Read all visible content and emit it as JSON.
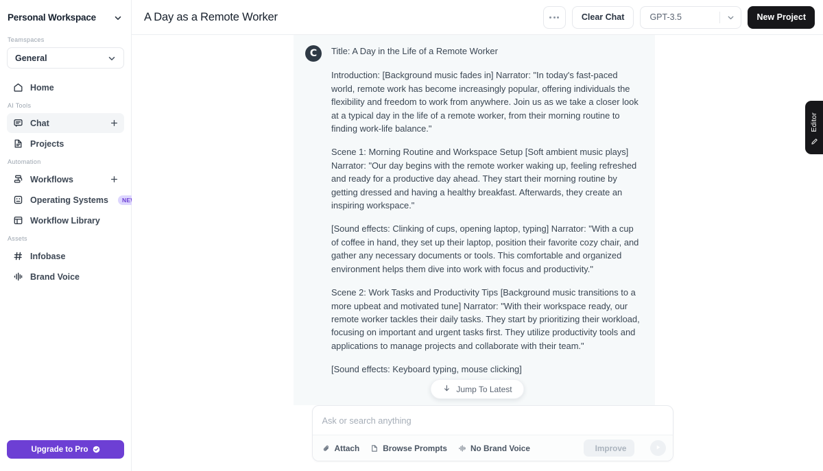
{
  "sidebar": {
    "workspace_title": "Personal Workspace",
    "workspace_chevron_icon": "chevron-down-icon",
    "teamspaces_label": "Teamspaces",
    "teamspace_selected": "General",
    "teamspace_chevron_icon": "chevron-down-icon",
    "home": {
      "label": "Home",
      "icon": "home-icon"
    },
    "ai_tools_label": "AI Tools",
    "ai_tools": [
      {
        "label": "Chat",
        "icon": "chat-bubble-icon",
        "action_icon": "plus-icon",
        "active": true
      },
      {
        "label": "Projects",
        "icon": "document-icon",
        "active": false
      }
    ],
    "automation_label": "Automation",
    "automation": [
      {
        "label": "Workflows",
        "icon": "workflow-icon",
        "action_icon": "plus-icon"
      },
      {
        "label": "Operating Systems",
        "icon": "grid-dots-icon",
        "badge": "NEW"
      },
      {
        "label": "Workflow Library",
        "icon": "library-layout-icon"
      }
    ],
    "assets_label": "Assets",
    "assets": [
      {
        "label": "Infobase",
        "icon": "hash-icon"
      },
      {
        "label": "Brand Voice",
        "icon": "audio-waveform-icon"
      }
    ],
    "upgrade": {
      "label": "Upgrade to Pro",
      "icon": "check-circle-icon",
      "color": "#6d3fd4"
    }
  },
  "topbar": {
    "page_title": "A Day as a Remote Worker",
    "more_icon": "ellipsis-icon",
    "clear_chat_label": "Clear Chat",
    "model_value": "GPT-3.5",
    "model_chevron_icon": "chevron-down-icon",
    "new_project_label": "New Project"
  },
  "chat": {
    "avatar_letter": "C",
    "avatar_name": "assistant-avatar",
    "paragraphs": [
      "Title: A Day in the Life of a Remote Worker",
      "Introduction:\n[Background music fades in]\nNarrator: \"In today's fast-paced world, remote work has become increasingly popular, offering individuals the flexibility and freedom to work from anywhere. Join us as we take a closer look at a typical day in the life of a remote worker, from their morning routine to finding work-life balance.\"",
      "Scene 1: Morning Routine and Workspace Setup\n[Soft ambient music plays]\nNarrator: \"Our day begins with the remote worker waking up, feeling refreshed and ready for a productive day ahead. They start their morning routine by getting dressed and having a healthy breakfast. Afterwards, they create an inspiring workspace.\"",
      "[Sound effects: Clinking of cups, opening laptop, typing]\nNarrator: \"With a cup of coffee in hand, they set up their laptop, position their favorite cozy chair, and gather any necessary documents or tools. This comfortable and organized environment helps them dive into work with focus and productivity.\"",
      "Scene 2: Work Tasks and Productivity Tips\n[Background music transitions to a more upbeat and motivated tune]\nNarrator: \"With their workspace ready, our remote worker tackles their daily tasks. They start by prioritizing their workload, focusing on important and urgent tasks first. They utilize productivity tools and applications to manage projects and collaborate with their team.\"",
      "[Sound effects: Keyboard typing, mouse clicking]"
    ],
    "jump_to_latest": {
      "label": "Jump To Latest",
      "icon": "arrow-down-icon"
    }
  },
  "composer": {
    "placeholder": "Ask or search anything",
    "value": "",
    "attach_label": "Attach",
    "attach_icon": "paperclip-icon",
    "browse_prompts_label": "Browse Prompts",
    "browse_prompts_icon": "document-icon",
    "brand_voice_label": "No Brand Voice",
    "brand_voice_icon": "audio-waveform-icon",
    "improve_label": "Improve",
    "improve_icon": "sparkles-icon",
    "send_icon": "send-play-icon"
  },
  "editor_tab": {
    "label": "Editor",
    "icon": "pencil-icon"
  }
}
